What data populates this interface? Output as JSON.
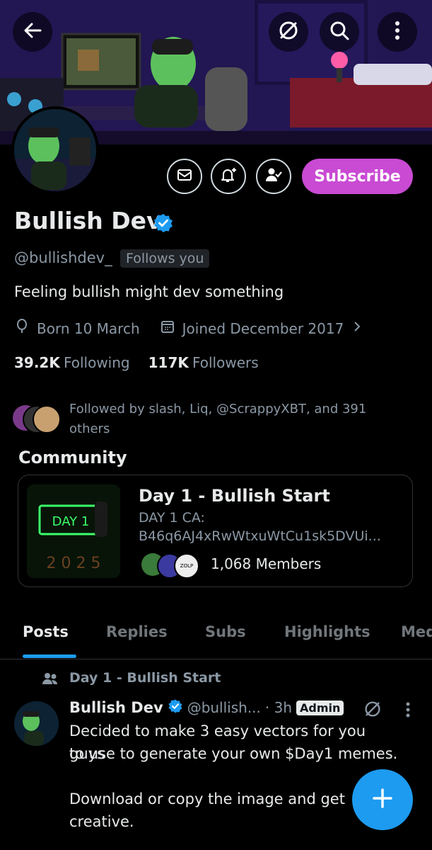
{
  "header": {
    "back_icon": "arrow-left-icon",
    "mute_icon": "circle-slash-icon",
    "search_icon": "search-icon",
    "more_icon": "vertical-ellipsis-icon"
  },
  "profile": {
    "name": "Bullish Dev",
    "handle": "@bullishdev_",
    "follows_you": "Follows you",
    "bio": "Feeling bullish might dev something",
    "birthday": "Born 10 March",
    "joined": "Joined December 2017",
    "following_count": "39.2K",
    "following_label": "Following",
    "followers_count": "117K",
    "followers_label": "Followers",
    "followed_by": "Followed by slash, Liq, @ScrappyXBT, and 391 others",
    "subscribe_label": "Subscribe",
    "verified_color": "#1d9bf0",
    "subscribe_color": "#c94ad3"
  },
  "community": {
    "section_title": "Community",
    "name": "Day 1 - Bullish Start",
    "ca_label": "DAY 1 CA:",
    "ca_value": "B46q6AJ4xRwWtxuWtCu1sk5DVUi...",
    "members": "1,068 Members",
    "image_text": "DAY 1",
    "member_badge": "ZOLP"
  },
  "tabs": [
    "Posts",
    "Replies",
    "Subs",
    "Highlights",
    "Med"
  ],
  "post": {
    "context": "Day 1 - Bullish Start",
    "author": "Bullish Dev",
    "handle": "@bullish...",
    "time": "· 3h",
    "badge": "Admin",
    "line1": "Decided to make 3 easy vectors for you guys",
    "line2": "to use to generate your own $Day1 memes.",
    "line3": "Download or copy the image and get",
    "line4": "creative."
  },
  "fab_icon": "plus-icon"
}
